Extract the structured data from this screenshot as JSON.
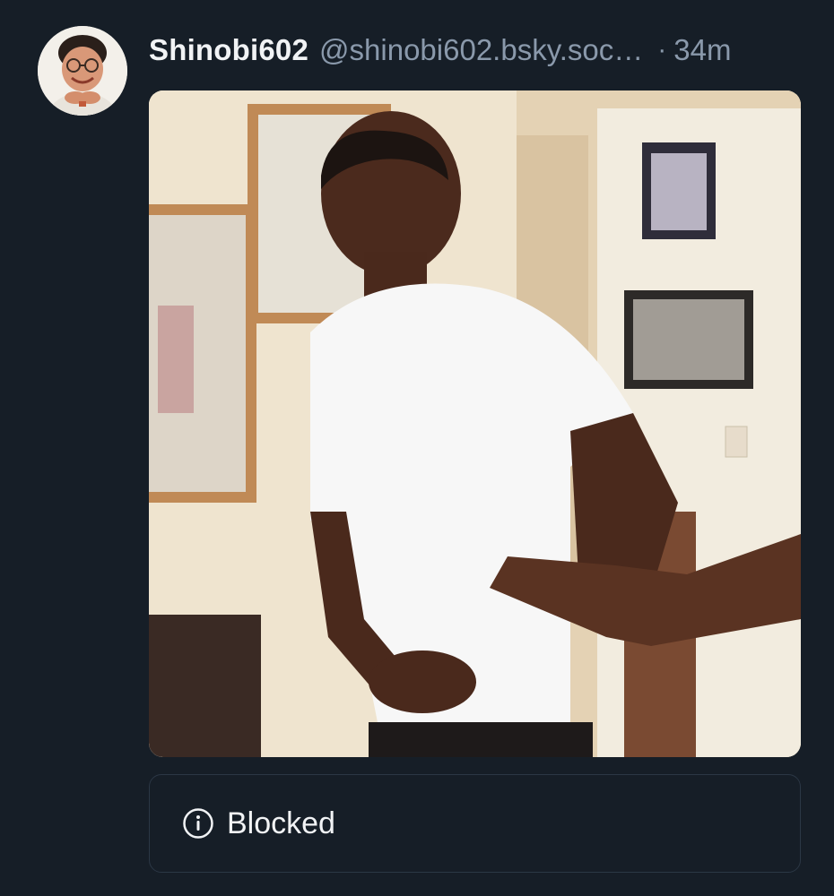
{
  "post": {
    "author": {
      "display_name": "Shinobi602",
      "handle": "@shinobi602.bsky.soc…"
    },
    "separator": "·",
    "timestamp": "34m",
    "embed": {
      "status_icon": "info-circle-icon",
      "label": "Blocked"
    }
  },
  "colors": {
    "background": "#161e27",
    "text_primary": "#f1f3f5",
    "text_secondary": "#8a99ab",
    "border": "#2b3745"
  }
}
